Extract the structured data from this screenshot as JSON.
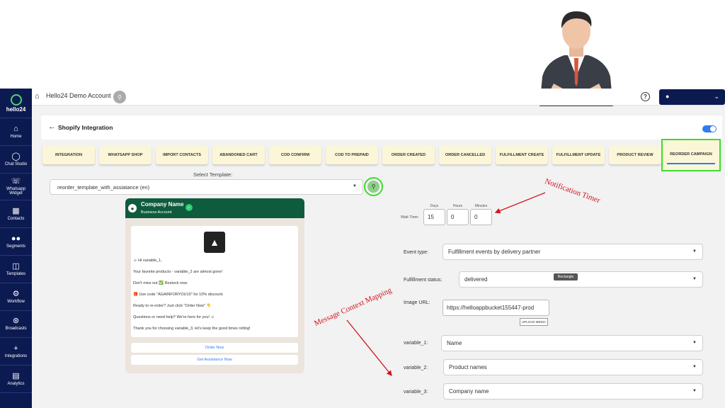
{
  "topbar": {
    "account_name": "Hello24 Demo Account"
  },
  "sidebar": {
    "brand": "hello24",
    "items": [
      {
        "label": "Home",
        "icon": "home-icon"
      },
      {
        "label": "Chat Studio",
        "icon": "chat-icon"
      },
      {
        "label": "Whatsapp Widget",
        "icon": "whatsapp-icon"
      },
      {
        "label": "Contacts",
        "icon": "contacts-icon"
      },
      {
        "label": "Segments",
        "icon": "segments-icon"
      },
      {
        "label": "Templates",
        "icon": "templates-icon"
      },
      {
        "label": "Workflow",
        "icon": "workflow-icon"
      },
      {
        "label": "Broadcasts",
        "icon": "broadcast-icon"
      },
      {
        "label": "Integrations",
        "icon": "plus-icon"
      },
      {
        "label": "Analytics",
        "icon": "analytics-icon"
      }
    ]
  },
  "header": {
    "title": "Shopify Integration",
    "toggle_on": true
  },
  "tabs": [
    "INTEGRATION",
    "WHATSAPP SHOP",
    "IMPORT CONTACTS",
    "ABANDONED CART",
    "COD CONFIRM",
    "COD TO PREPAID",
    "ORDER CREATED",
    "ORDER CANCELLED",
    "FULFILLMENT CREATE",
    "FULFILLMENT UPDATE",
    "PRODUCT REVIEW",
    "REORDER CAMPAIGN"
  ],
  "active_tab": "REORDER CAMPAIGN",
  "template": {
    "label": "Select Template:",
    "value": "reorder_template_with_assiatance (en)"
  },
  "preview": {
    "company_name": "Company Name",
    "account_type": "Business Account",
    "lines": [
      "☺ Hi variable_1,",
      "Your favorite products - variable_2 are almost gone!",
      "Don't miss out ✅ Restock now.",
      "🎁 Use code \"AGAINFORYOU10\" for 10% discount.",
      "Ready to re-order? Just click \"Order Now\" 👇",
      "Questions or need help? We're here for you! ☺",
      "Thank you for choosing variable_3, let's keep the good times rolling!"
    ],
    "buttons": [
      "Order Now",
      "Get Assistance Now"
    ]
  },
  "wait_time": {
    "label": "Wait Time:",
    "days_label": "Days",
    "hours_label": "Hours",
    "minutes_label": "Minutes",
    "days": "15",
    "hours": "0",
    "minutes": "0"
  },
  "form": {
    "event_type_label": "Event type:",
    "event_type": "Fulfillment events by delivery partner",
    "fulfillment_status_label": "Fulfillment status:",
    "fulfillment_status": "delivered",
    "image_url_label": "Image URL:",
    "image_url": "https://helloappbucket155447-prod",
    "upload_label": "UPLOAD MEDIA",
    "var1_label": "variable_1:",
    "var1": "Name",
    "var2_label": "variable_2:",
    "var2": "Product names",
    "var3_label": "variable_3:",
    "var3": "Company name",
    "tooltip": "Rectangle"
  },
  "annotations": {
    "timer": "Notification Timer",
    "mapping": "Message Context Mapping"
  }
}
